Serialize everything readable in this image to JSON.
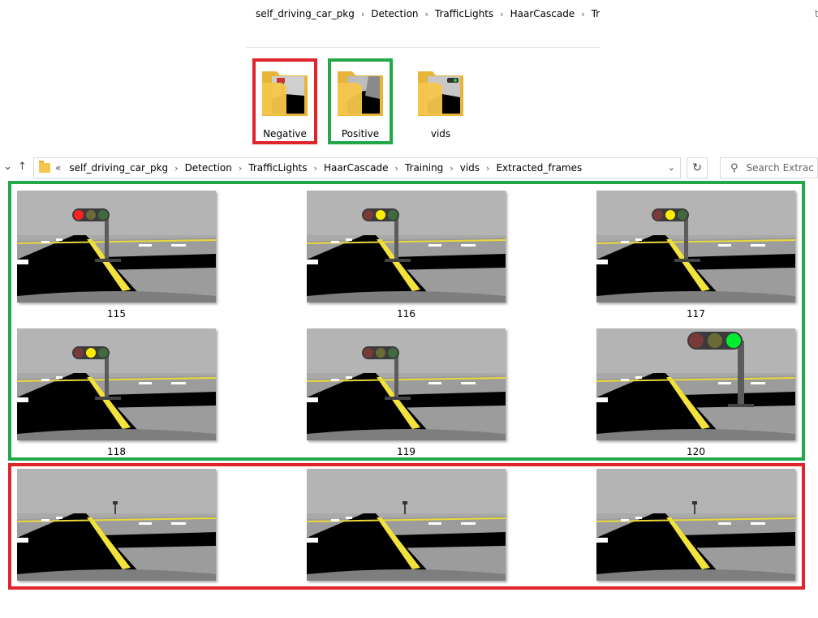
{
  "top_explorer": {
    "breadcrumb": [
      "self_driving_car_pkg",
      "Detection",
      "TrafficLights",
      "HaarCascade",
      "Training"
    ],
    "right_fragment": "t",
    "folders": [
      {
        "label": "Negative",
        "highlight": "#e0242b"
      },
      {
        "label": "Positive",
        "highlight": "#22a84a"
      },
      {
        "label": "vids",
        "highlight": ""
      }
    ]
  },
  "address_bar": {
    "overflow_marker": "«",
    "breadcrumb": [
      "self_driving_car_pkg",
      "Detection",
      "TrafficLights",
      "HaarCascade",
      "Training",
      "vids",
      "Extracted_frames"
    ],
    "search_placeholder": "Search Extrac"
  },
  "frames_positive": [
    {
      "label": "115",
      "light": "red"
    },
    {
      "label": "116",
      "light": "yellow"
    },
    {
      "label": "117",
      "light": "yellow"
    },
    {
      "label": "118",
      "light": "yellow"
    },
    {
      "label": "119",
      "light": "off"
    },
    {
      "label": "120",
      "light": "green"
    }
  ],
  "frames_negative": [
    {
      "label": "",
      "light": "none"
    },
    {
      "label": "",
      "light": "none"
    },
    {
      "label": "",
      "light": "none"
    }
  ],
  "colors": {
    "positive_box": "#22a84a",
    "negative_box": "#e0242b",
    "folder": "#f5c64c"
  },
  "icons": {
    "back": "←",
    "up": "↑",
    "dropdown": "⌄",
    "refresh": "↻",
    "search": "⚲",
    "chevron": "›"
  }
}
